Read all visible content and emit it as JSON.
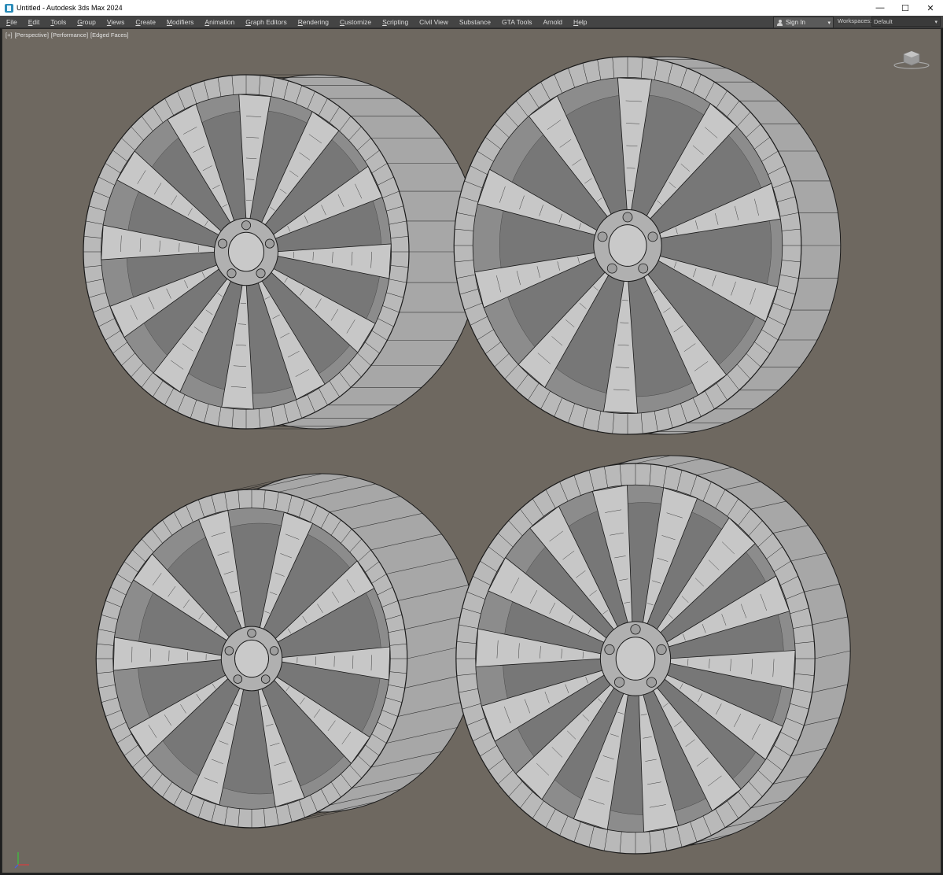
{
  "window": {
    "title": "Untitled - Autodesk 3ds Max 2024",
    "minimize_glyph": "—",
    "maximize_glyph": "☐",
    "close_glyph": "✕"
  },
  "menu": {
    "items": [
      {
        "label": "File",
        "ul": "F",
        "rest": "ile"
      },
      {
        "label": "Edit",
        "ul": "E",
        "rest": "dit"
      },
      {
        "label": "Tools",
        "ul": "T",
        "rest": "ools"
      },
      {
        "label": "Group",
        "ul": "G",
        "rest": "roup"
      },
      {
        "label": "Views",
        "ul": "V",
        "rest": "iews"
      },
      {
        "label": "Create",
        "ul": "C",
        "rest": "reate"
      },
      {
        "label": "Modifiers",
        "ul": "M",
        "rest": "odifiers"
      },
      {
        "label": "Animation",
        "ul": "A",
        "rest": "nimation"
      },
      {
        "label": "Graph Editors",
        "ul": "G",
        "rest": "raph Editors"
      },
      {
        "label": "Rendering",
        "ul": "R",
        "rest": "endering"
      },
      {
        "label": "Customize",
        "ul": "C",
        "rest": "ustomize"
      },
      {
        "label": "Scripting",
        "ul": "S",
        "rest": "cripting"
      },
      {
        "label": "Civil View",
        "ul": "",
        "rest": "Civil View"
      },
      {
        "label": "Substance",
        "ul": "",
        "rest": "Substance"
      },
      {
        "label": "GTA Tools",
        "ul": "",
        "rest": "GTA Tools"
      },
      {
        "label": "Arnold",
        "ul": "",
        "rest": "Arnold"
      },
      {
        "label": "Help",
        "ul": "H",
        "rest": "elp"
      }
    ],
    "sign_in": "Sign In",
    "workspaces_label": "Workspaces:",
    "workspaces_value": "Default",
    "caret": "▾"
  },
  "viewport": {
    "labels": [
      "[+]",
      "[Perspective]",
      "[Performance]",
      "[Edged Faces]"
    ],
    "background": "#6e6860",
    "wheel_color": "#b9b9b9",
    "wire_color": "#1a1a1a"
  },
  "scene": {
    "wheels": [
      {
        "name": "wheel-top-left",
        "spokes": 12
      },
      {
        "name": "wheel-top-right",
        "spokes": 10
      },
      {
        "name": "wheel-bottom-left",
        "spokes": 10
      },
      {
        "name": "wheel-bottom-right",
        "spokes": 14
      }
    ]
  },
  "icons": {
    "app": "3ds-max-icon",
    "user": "user-icon",
    "viewcube": "viewcube-icon",
    "axis": "axis-tripod-icon"
  }
}
